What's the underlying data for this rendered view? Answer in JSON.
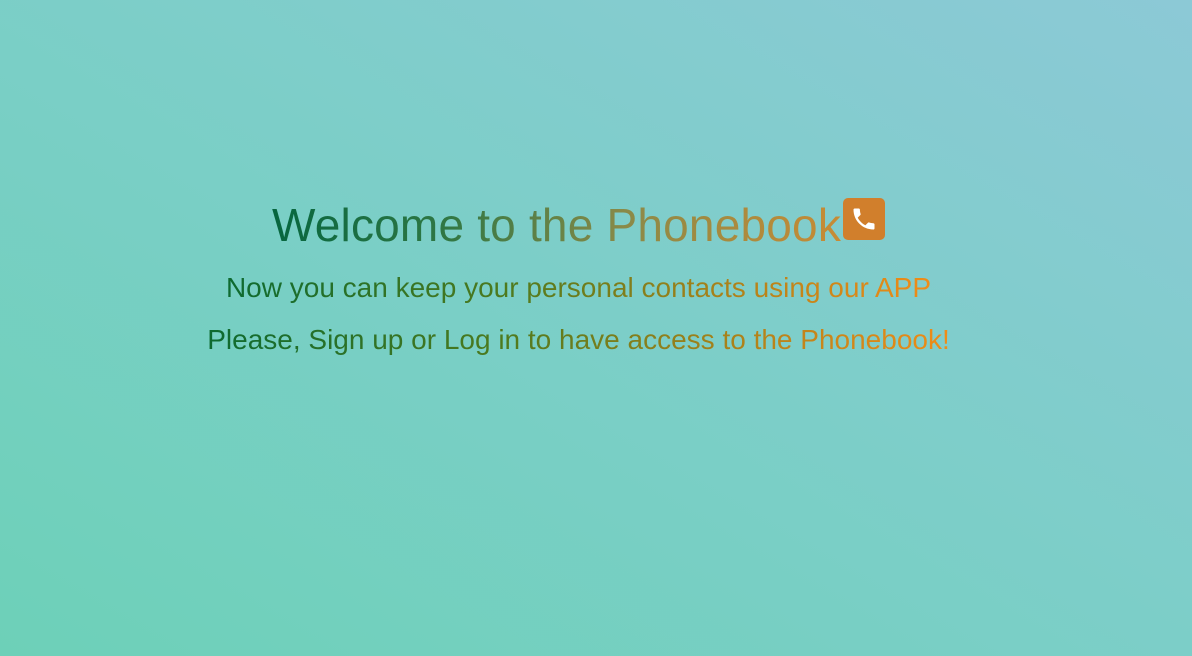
{
  "hero": {
    "title": "Welcome to the Phonebook",
    "title_icon": "phone-icon",
    "subtitle": "Now you can keep your personal contacts using our APP",
    "cta_text": "Please, Sign up or Log in to have access to the Phonebook!"
  },
  "colors": {
    "background_start": "#6dd0b8",
    "background_end": "#8cc9d6",
    "text_green": "#06663f",
    "text_orange": "#f08c18",
    "icon_bg": "#d17f2c"
  }
}
